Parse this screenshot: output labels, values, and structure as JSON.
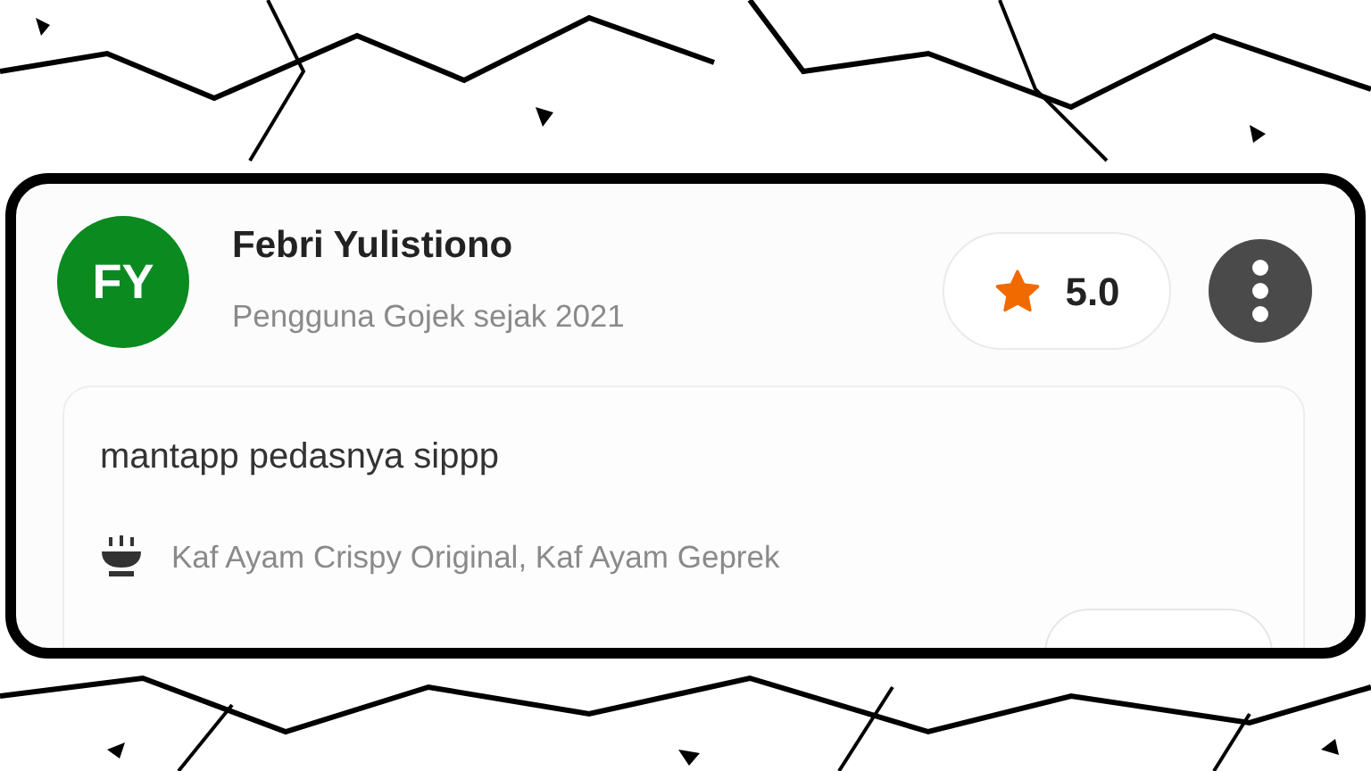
{
  "review": {
    "avatar_initials": "FY",
    "name": "Febri Yulistiono",
    "subtitle": "Pengguna Gojek sejak 2021",
    "rating": "5.0",
    "comment": "mantapp pedasnya sippp",
    "ordered_items": "Kaf Ayam Crispy Original, Kaf Ayam Geprek"
  }
}
